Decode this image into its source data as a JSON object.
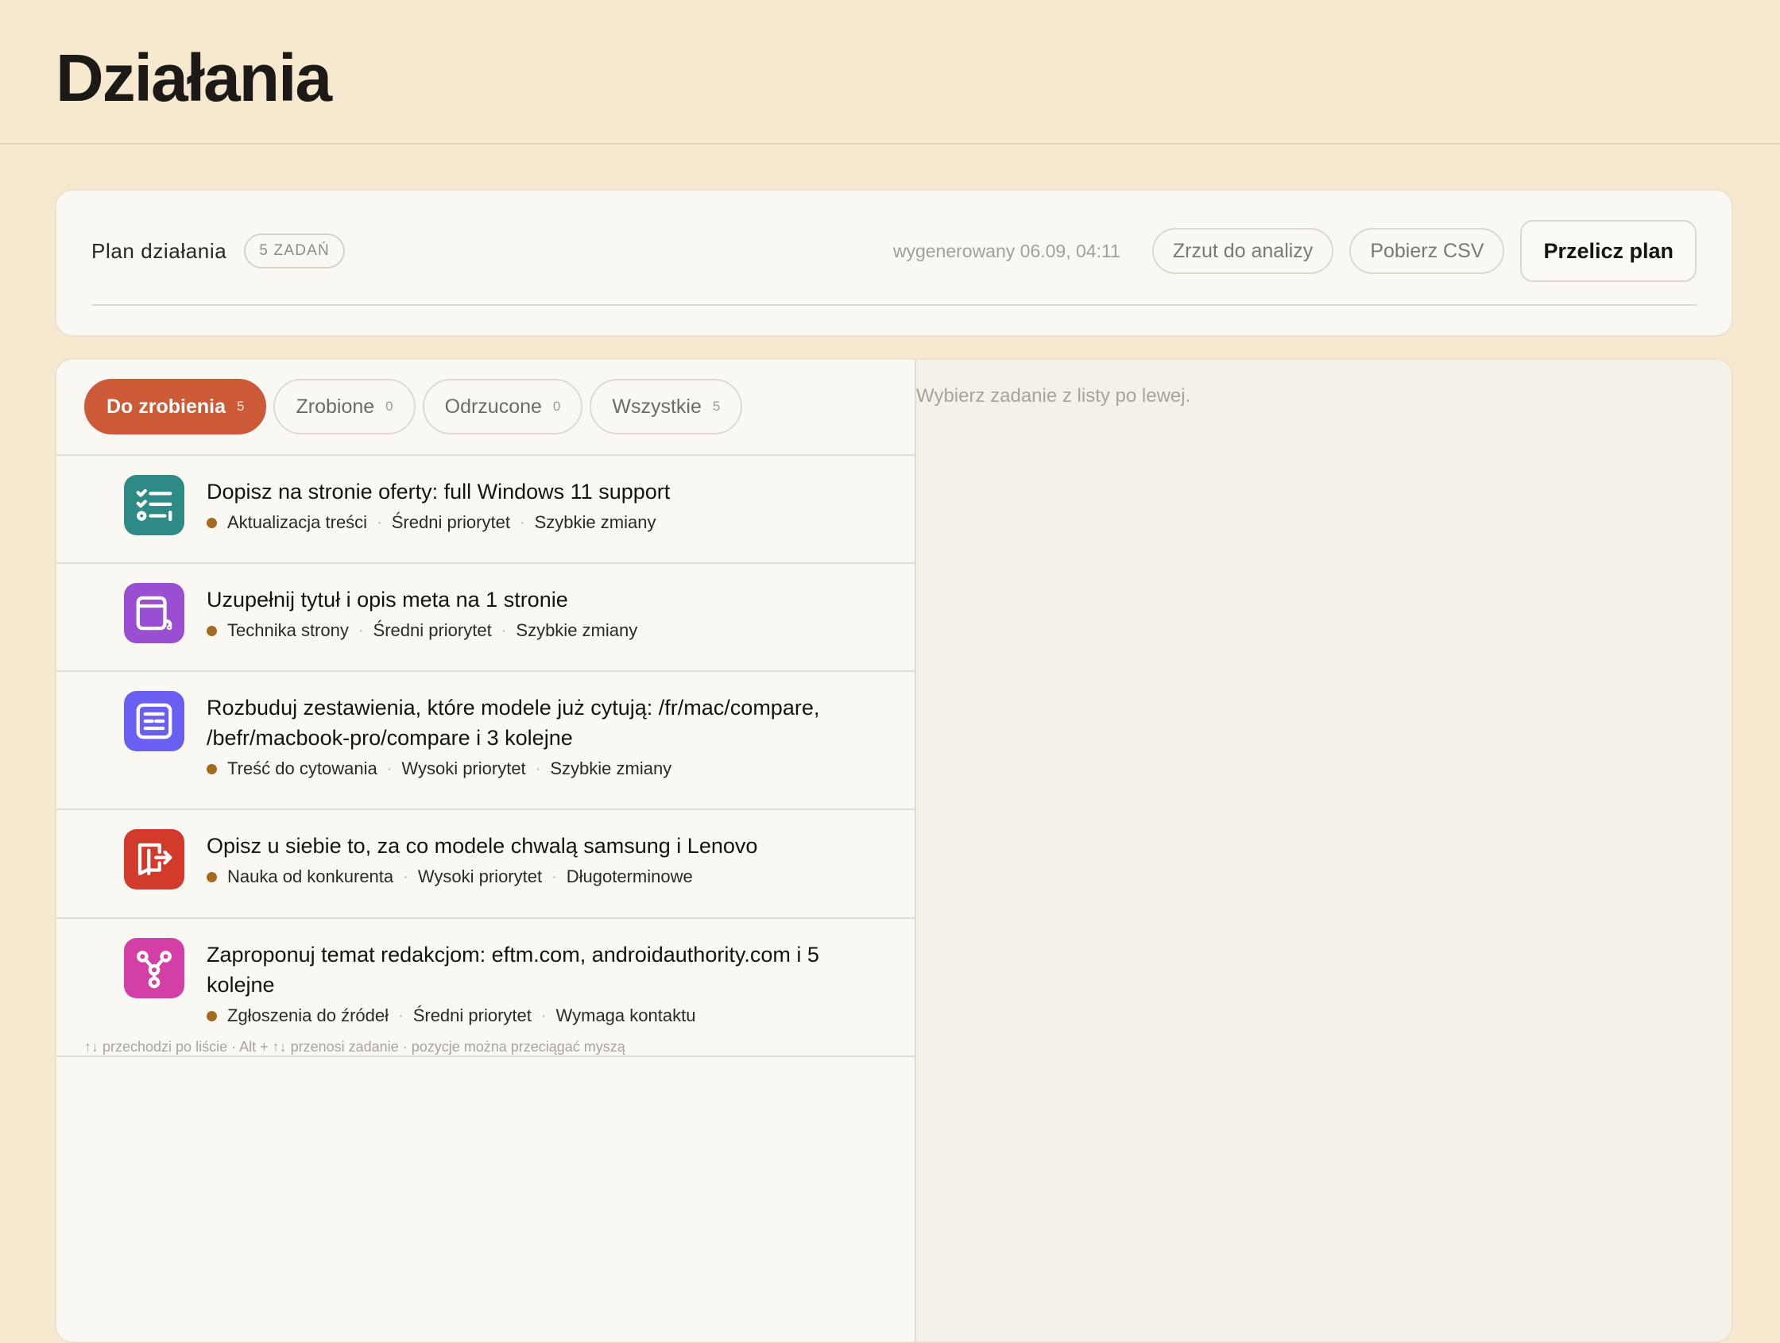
{
  "page": {
    "title": "Działania"
  },
  "plan": {
    "title": "Plan działania",
    "badge": "5 ZADAŃ",
    "generated": "wygenerowany 06.09, 04:11",
    "snapshot_label": "Zrzut do analizy",
    "csv_label": "Pobierz CSV",
    "recalc_label": "Przelicz plan"
  },
  "tabs": [
    {
      "label": "Do zrobienia",
      "count": "5",
      "active": true
    },
    {
      "label": "Zrobione",
      "count": "0",
      "active": false
    },
    {
      "label": "Odrzucone",
      "count": "0",
      "active": false
    },
    {
      "label": "Wszystkie",
      "count": "5",
      "active": false
    }
  ],
  "tasks": [
    {
      "title": "Dopisz na stronie oferty: full Windows 11 support",
      "category": "Aktualizacja treści",
      "priority": "Średni priorytet",
      "effort": "Szybkie zmiany",
      "icon": "checklist-icon",
      "color": "#2e8a85"
    },
    {
      "title": "Uzupełnij tytuł i opis meta na 1 stronie",
      "category": "Technika strony",
      "priority": "Średni priorytet",
      "effort": "Szybkie zmiany",
      "icon": "browser-window-icon",
      "color": "#9a4fd2"
    },
    {
      "title": "Rozbuduj zestawienia, które modele już cytują: /fr/mac/compare, /befr/macbook-pro/compare i 3 kolejne",
      "category": "Treść do cytowania",
      "priority": "Wysoki priorytet",
      "effort": "Szybkie zmiany",
      "icon": "document-lines-icon",
      "color": "#6a5ff0"
    },
    {
      "title": "Opisz u siebie to, za co modele chwalą samsung i Lenovo",
      "category": "Nauka od konkurenta",
      "priority": "Wysoki priorytet",
      "effort": "Długoterminowe",
      "icon": "book-arrow-icon",
      "color": "#d23a2c"
    },
    {
      "title": "Zaproponuj temat redakcjom: eftm.com, androidauthority.com i 5 kolejne",
      "category": "Zgłoszenia do źródeł",
      "priority": "Średni priorytet",
      "effort": "Wymaga kontaktu",
      "icon": "network-nodes-icon",
      "color": "#d43fa6"
    }
  ],
  "hint": "↑↓ przechodzi po liście · Alt + ↑↓ przenosi zadanie · pozycje można przeciągać myszą",
  "detail": {
    "placeholder": "Wybierz zadanie z listy po lewej."
  }
}
